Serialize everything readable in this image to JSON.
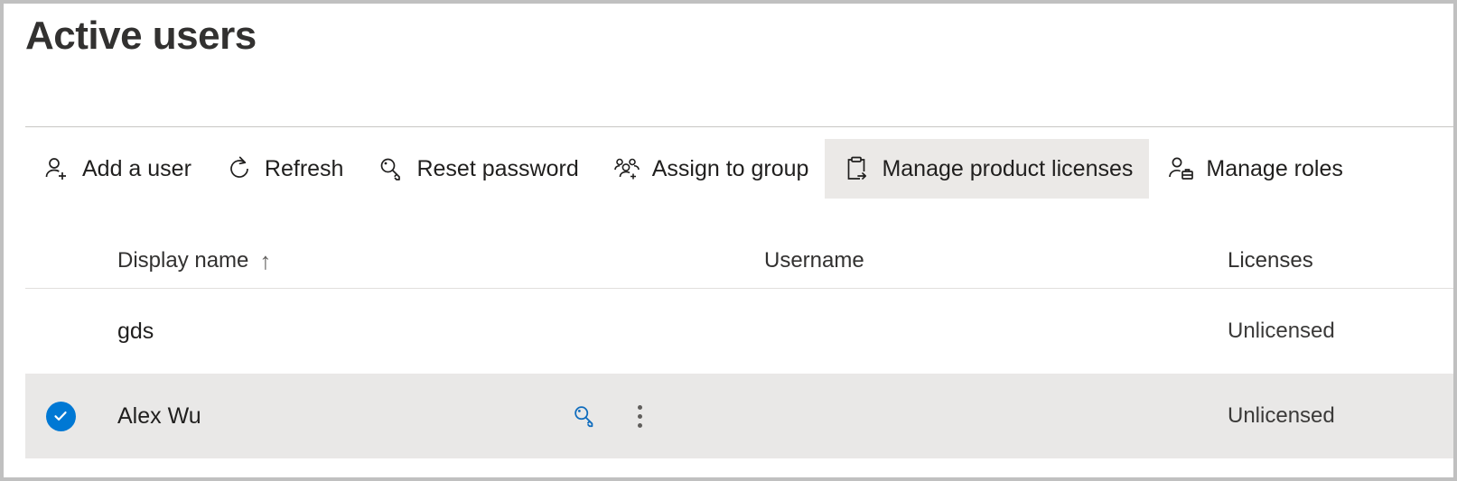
{
  "page": {
    "title": "Active users"
  },
  "command_bar": {
    "items": [
      {
        "id": "add-a-user",
        "label": "Add a user",
        "icon": "person-add-icon",
        "highlighted": false
      },
      {
        "id": "refresh",
        "label": "Refresh",
        "icon": "refresh-icon",
        "highlighted": false
      },
      {
        "id": "reset-password",
        "label": "Reset password",
        "icon": "key-icon",
        "highlighted": false
      },
      {
        "id": "assign-to-group",
        "label": "Assign to group",
        "icon": "people-add-icon",
        "highlighted": false
      },
      {
        "id": "manage-product-licenses",
        "label": "Manage product licenses",
        "icon": "clipboard-arrow-icon",
        "highlighted": true
      },
      {
        "id": "manage-roles",
        "label": "Manage roles",
        "icon": "person-briefcase-icon",
        "highlighted": false
      }
    ]
  },
  "table": {
    "columns": {
      "display_name": "Display name",
      "display_name_sort": "↑",
      "username": "Username",
      "licenses": "Licenses"
    },
    "rows": [
      {
        "display_name": "gds",
        "username": "",
        "licenses": "Unlicensed",
        "selected": false,
        "checked": false
      },
      {
        "display_name": "Alex Wu",
        "username": "",
        "licenses": "Unlicensed",
        "selected": true,
        "checked": true
      }
    ]
  },
  "colors": {
    "accent": "#0078d4",
    "row_icon_blue": "#0f6cbd",
    "highlight_bg": "#ebe9e7",
    "selected_row_bg": "#e9e8e7",
    "divider": "#c8c6c4",
    "text_primary": "#201f1e",
    "text_secondary": "#3b3a39",
    "page_border": "#c0c0c0"
  }
}
